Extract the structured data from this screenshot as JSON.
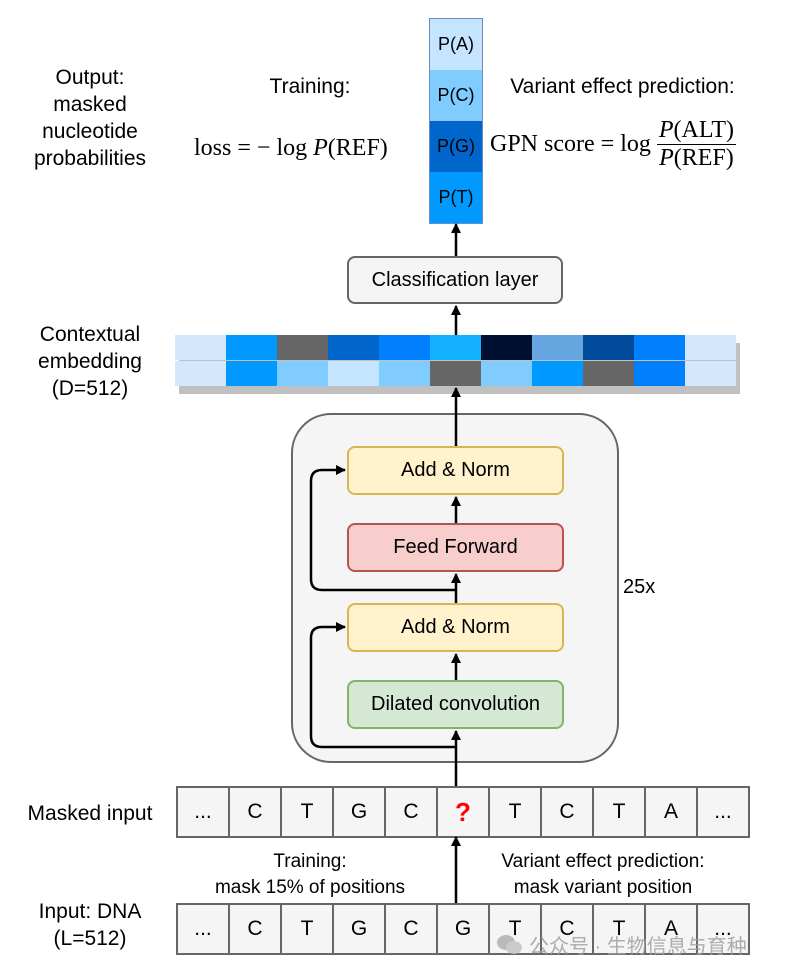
{
  "output_label": [
    "Output:",
    "masked",
    "nucleotide",
    "probabilities"
  ],
  "training_heading": "Training:",
  "loss_formula": {
    "lhs": "loss",
    "eq": "=",
    "rhs_prefix": "− log",
    "P": "P",
    "arg": "(REF)"
  },
  "variant_heading": "Variant effect prediction:",
  "gpn_formula": {
    "lhs": "GPN score",
    "eq": "=",
    "log": "log",
    "num_P": "P",
    "num_arg": "(ALT)",
    "den_P": "P",
    "den_arg": "(REF)"
  },
  "probabilities": [
    {
      "label": "P(A)",
      "color": "#c5e4ff"
    },
    {
      "label": "P(C)",
      "color": "#80ccff"
    },
    {
      "label": "P(G)",
      "color": "#0066cc"
    },
    {
      "label": "P(T)",
      "color": "#0099ff"
    }
  ],
  "classification_layer": "Classification layer",
  "embedding_label": [
    "Contextual",
    "embedding",
    "(D=512)"
  ],
  "embedding_colors": {
    "row1": [
      "#d4e8fb",
      "#0099ff",
      "#666666",
      "#0066cc",
      "#0080ff",
      "#14b1ff",
      "#001030",
      "#66a6e0",
      "#004c9a",
      "#0080ff",
      "#d4e8fb"
    ],
    "row2": [
      "#d4e8fb",
      "#0099ff",
      "#80ccff",
      "#c5e4ff",
      "#80ccff",
      "#666666",
      "#80ccff",
      "#0099ff",
      "#666666",
      "#0080ff",
      "#d4e8fb"
    ]
  },
  "block": {
    "repeat": "25x",
    "add_norm_top": "Add & Norm",
    "feed_forward": "Feed Forward",
    "add_norm_bottom": "Add & Norm",
    "dilated_conv": "Dilated convolution"
  },
  "masked_input_label": "Masked input",
  "masked_sequence": [
    "...",
    "C",
    "T",
    "G",
    "C",
    "?",
    "T",
    "C",
    "T",
    "A",
    "..."
  ],
  "training_mask": [
    "Training:",
    "mask 15% of positions"
  ],
  "variant_mask": [
    "Variant effect prediction:",
    "mask variant position"
  ],
  "input_label": [
    "Input: DNA",
    "(L=512)"
  ],
  "input_sequence": [
    "...",
    "C",
    "T",
    "G",
    "C",
    "G",
    "T",
    "C",
    "T",
    "A",
    "..."
  ],
  "watermark": "公众号 · 生物信息与育种",
  "colors": {
    "mask_question": "#ff0000",
    "add_norm_fill": "#fff2cc",
    "add_norm_stroke": "#d6b656",
    "ff_fill": "#f8cecc",
    "ff_stroke": "#b85450",
    "conv_fill": "#d5e8d4",
    "conv_stroke": "#82b366"
  }
}
